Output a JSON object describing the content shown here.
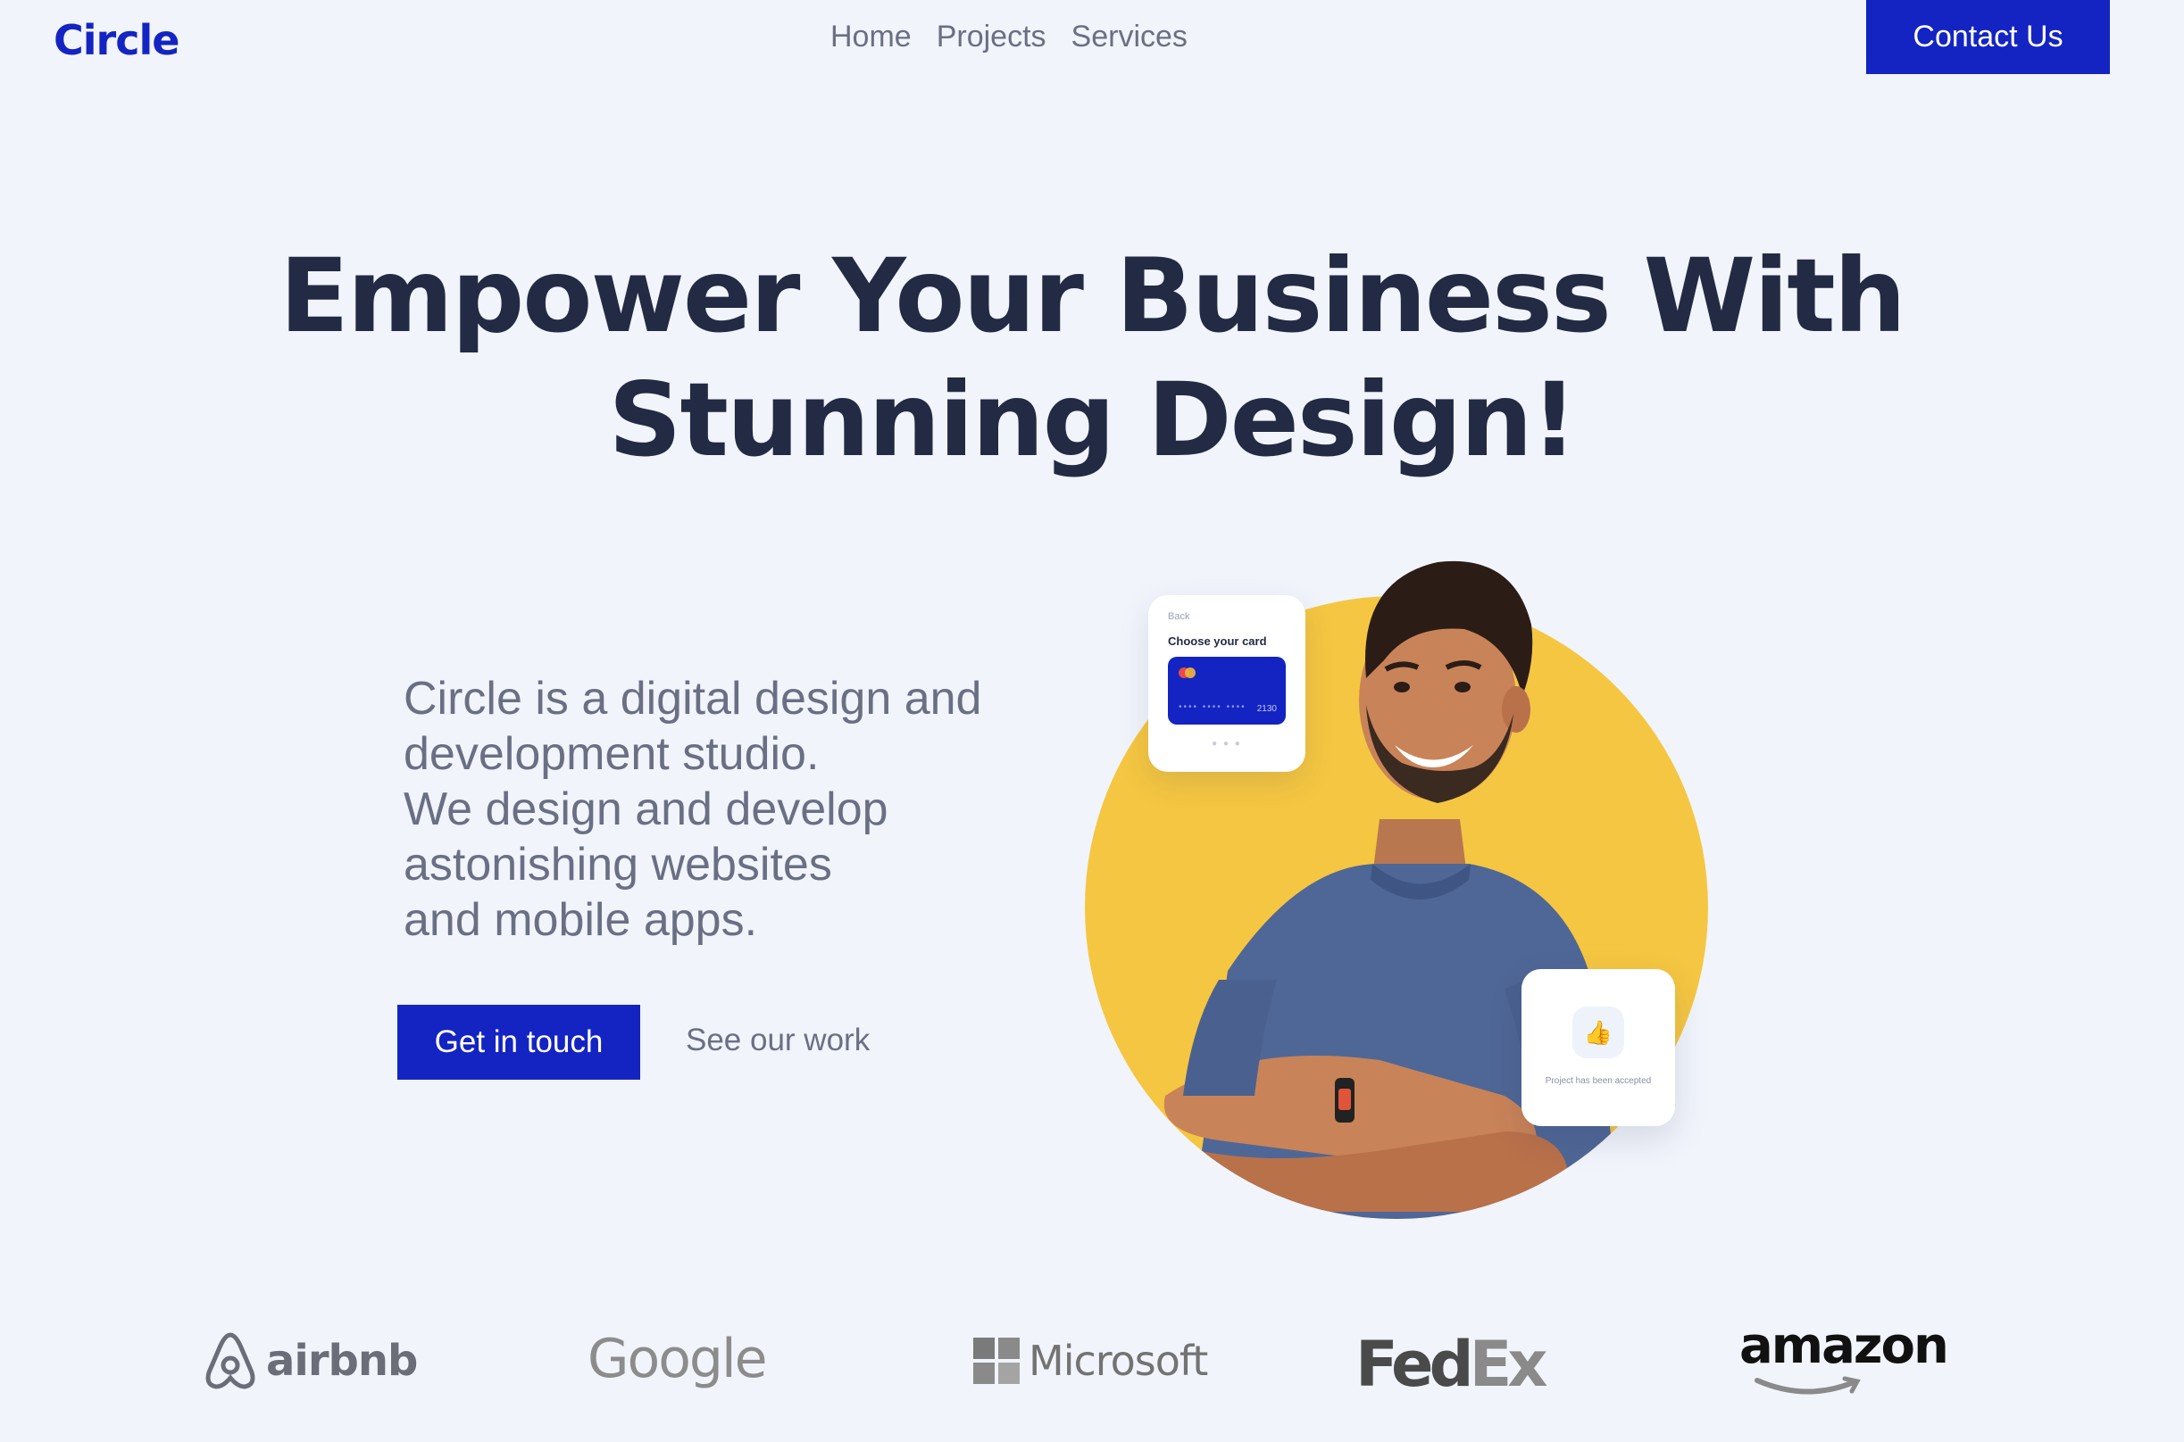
{
  "nav": {
    "logo": "Circle",
    "links": [
      "Home",
      "Projects",
      "Services"
    ],
    "contact_label": "Contact Us"
  },
  "hero": {
    "headline_line1": "Empower Your Business With",
    "headline_line2": "Stunning Design!",
    "intro_line1": "Circle is a digital design and",
    "intro_line2": "development studio.",
    "intro_line3": "We design and develop",
    "intro_line4": "astonishing websites",
    "intro_line5": "and mobile apps.",
    "primary_cta": "Get in touch",
    "secondary_cta": "See our work"
  },
  "illustration": {
    "card_top": {
      "back": "Back",
      "title": "Choose your card",
      "card_number": "2130"
    },
    "card_bottom": {
      "message": "Project has been accepted"
    }
  },
  "brands": [
    "airbnb",
    "Google",
    "Microsoft",
    "Fed",
    "Ex",
    "amazon"
  ],
  "colors": {
    "primary": "#1424c2",
    "background": "#f1f4fb",
    "heading": "#232a44",
    "muted": "#6a6f84",
    "accent_yellow": "#f5c641"
  }
}
